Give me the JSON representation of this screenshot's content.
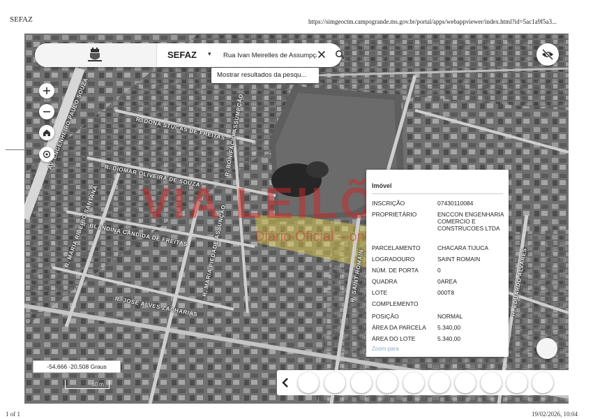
{
  "print_header": {
    "title": "SEFAZ",
    "url": "https://simgeoctm.campogrande.ms.gov.br/portal/apps/webappviewer/index.html?id=5ac1a9f5a3..."
  },
  "print_footer": {
    "page": "1 of 1",
    "date": "19/02/2026, 10:04"
  },
  "search": {
    "app_name": "SEFAZ",
    "dropdown_caret": "▾",
    "query": "Rua Ivan Meirelles de Assumpção",
    "suggestion": "Mostrar resultados da pesqu..."
  },
  "map": {
    "coordinates": "-54,666 -20,508 Graus",
    "scale": "60 m",
    "streets": [
      "R. DONA STUCAS DE FREITAS",
      "R. DIOMAR OLIVEIRA DE SOUZA",
      "R. BLANDINA CANDIDA DE FREITAS",
      "R. JOSÉ ALVES ZACHARIAS",
      "AV. ENGENHEIRO PAULO SOUZA",
      "R. MARIA PIEDADE ASSUNÇÃO",
      "R. MARIA RIBEIRO SANTANA",
      "R. SAINT ROMAIN",
      "R. EDUARDO ALVARES",
      "R. BONIFÁCIO ASSUMPÇÃO"
    ],
    "watermark": "VIA LEILÕES",
    "watermark_sub": "Diário Oficial – on line"
  },
  "popup": {
    "title": "Imóvel",
    "rows": [
      {
        "label": "INSCRIÇÃO",
        "value": "07430110084"
      },
      {
        "label": "PROPRIETÁRIO",
        "value": "ENCCON ENGENHARIA COMERCIO E CONSTRUCOES LTDA"
      },
      {
        "label": "PARCELAMENTO",
        "value": "CHACARA TIJUCA"
      },
      {
        "label": "LOGRADOURO",
        "value": "SAINT ROMAIN"
      },
      {
        "label": "NÚM. DE PORTA",
        "value": "0"
      },
      {
        "label": "QUADRA",
        "value": "0AREA"
      },
      {
        "label": "LOTE",
        "value": "000T8"
      },
      {
        "label": "COMPLEMENTO",
        "value": ""
      },
      {
        "label": "POSIÇÃO",
        "value": "NORMAL"
      },
      {
        "label": "ÁREA DA PARCELA",
        "value": "5.340,00"
      },
      {
        "label": "ÁREA DO LOTE",
        "value": "5.340,00"
      }
    ],
    "zoom_link": "Zoom para"
  },
  "icons": {
    "zoom_in": "plus-icon",
    "zoom_out": "minus-icon",
    "home": "home-icon",
    "locate": "crosshair-icon",
    "layer_visibility": "eye-off-icon",
    "clear": "close-icon",
    "search": "search-icon",
    "carousel_prev": "chevron-left-icon"
  },
  "colors": {
    "highlight_parcel": "#e6d24a",
    "watermark": "#cd2828",
    "link": "#8aa9c9"
  }
}
